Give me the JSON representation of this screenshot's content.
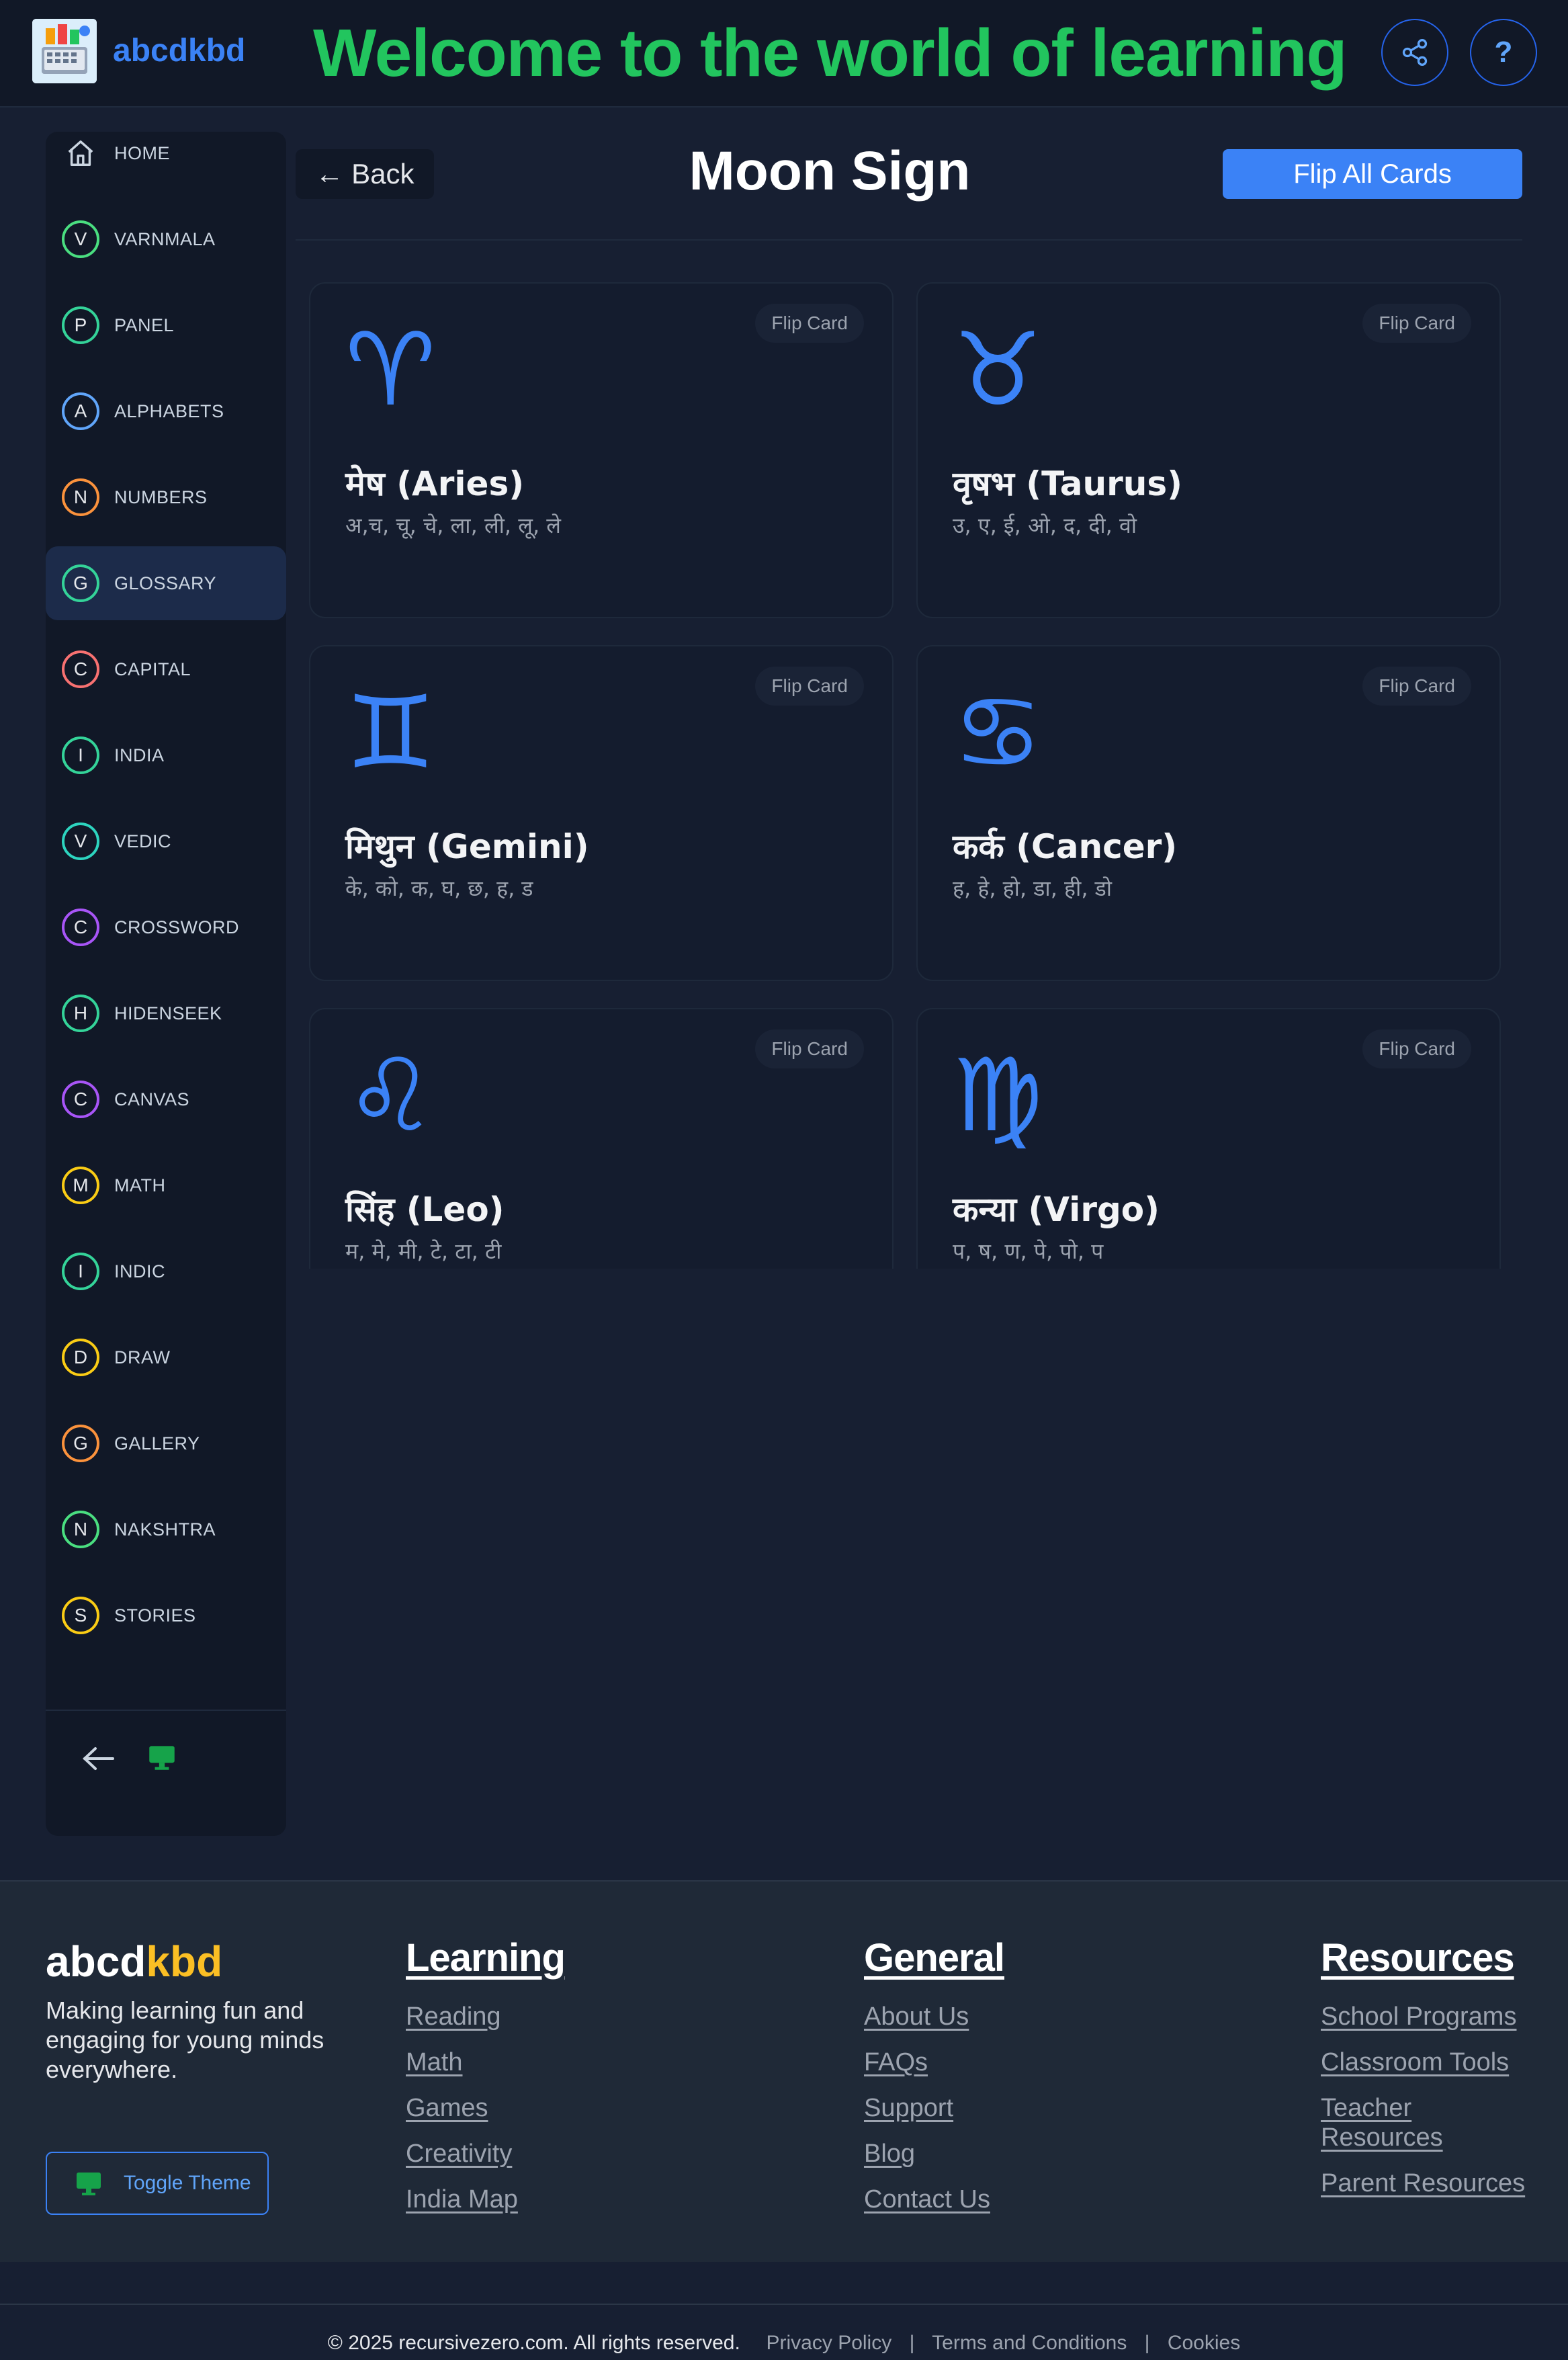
{
  "header": {
    "brand": "abcdkbd",
    "welcome": "Welcome to the world of learning",
    "help_label": "?"
  },
  "sidebar": {
    "items": [
      {
        "icon": "home-icon",
        "letter": "",
        "label": "HOME",
        "color": "#9ca3af"
      },
      {
        "letter": "V",
        "label": "VARNMALA",
        "color": "#4ade80"
      },
      {
        "letter": "P",
        "label": "PANEL",
        "color": "#34d399"
      },
      {
        "letter": "A",
        "label": "ALPHABETS",
        "color": "#60a5fa"
      },
      {
        "letter": "N",
        "label": "NUMBERS",
        "color": "#fb923c"
      },
      {
        "letter": "G",
        "label": "GLOSSARY",
        "color": "#34d399",
        "active": true
      },
      {
        "letter": "C",
        "label": "CAPITAL",
        "color": "#f87171"
      },
      {
        "letter": "I",
        "label": "INDIA",
        "color": "#34d399"
      },
      {
        "letter": "V",
        "label": "VEDIC",
        "color": "#2dd4bf"
      },
      {
        "letter": "C",
        "label": "CROSSWORD",
        "color": "#a855f7"
      },
      {
        "letter": "H",
        "label": "HIDENSEEK",
        "color": "#34d399"
      },
      {
        "letter": "C",
        "label": "CANVAS",
        "color": "#a855f7"
      },
      {
        "letter": "M",
        "label": "MATH",
        "color": "#facc15"
      },
      {
        "letter": "I",
        "label": "INDIC",
        "color": "#34d399"
      },
      {
        "letter": "D",
        "label": "DRAW",
        "color": "#facc15"
      },
      {
        "letter": "G",
        "label": "GALLERY",
        "color": "#fb923c"
      },
      {
        "letter": "N",
        "label": "NAKSHTRA",
        "color": "#4ade80"
      },
      {
        "letter": "S",
        "label": "STORIES",
        "color": "#facc15"
      }
    ]
  },
  "main": {
    "back_label": "← Back",
    "title": "Moon Sign",
    "flip_all_label": "Flip All Cards",
    "flip_card_label": "Flip Card",
    "cards": [
      {
        "symbol": "♈",
        "name": "मेष (Aries)",
        "letters": "अ,च, चू, चे, ला, ली, लू, ले"
      },
      {
        "symbol": "♉",
        "name": "वृषभ (Taurus)",
        "letters": "उ, ए, ई, ओ, द, दी, वो"
      },
      {
        "symbol": "♊",
        "name": "मिथुन (Gemini)",
        "letters": "के, को, क, घ, छ, ह, ड"
      },
      {
        "symbol": "♋",
        "name": "कर्क (Cancer)",
        "letters": "ह, हे, हो, डा, ही, डो"
      },
      {
        "symbol": "♌",
        "name": "सिंह (Leo)",
        "letters": "म, मे, मी, टे, टा, टी"
      },
      {
        "symbol": "♍",
        "name": "कन्या (Virgo)",
        "letters": "प, ष, ण, पे, पो, प"
      }
    ]
  },
  "footer": {
    "brand_main": "abcd",
    "brand_accent": "kbd",
    "tagline": "Making learning fun and engaging for young minds everywhere.",
    "toggle_theme_label": "Toggle Theme",
    "columns": [
      {
        "heading": "Learning",
        "links": [
          "Reading",
          "Math",
          "Games",
          "Creativity",
          "India Map"
        ]
      },
      {
        "heading": "General",
        "links": [
          "About Us",
          "FAQs",
          "Support",
          "Blog",
          "Contact Us"
        ]
      },
      {
        "heading": "Resources",
        "links": [
          "School Programs",
          "Classroom Tools",
          "Teacher Resources",
          "Parent Resources"
        ]
      }
    ],
    "copyright": "© 2025 recursivezero.com. All rights reserved.",
    "legal": [
      "Privacy Policy",
      "Terms and Conditions",
      "Cookies"
    ],
    "separator": "|"
  },
  "colors": {
    "accent_blue": "#3b82f6",
    "welcome_green": "#22c55e",
    "brand_yellow": "#fbbf24",
    "background": "#171f32"
  }
}
